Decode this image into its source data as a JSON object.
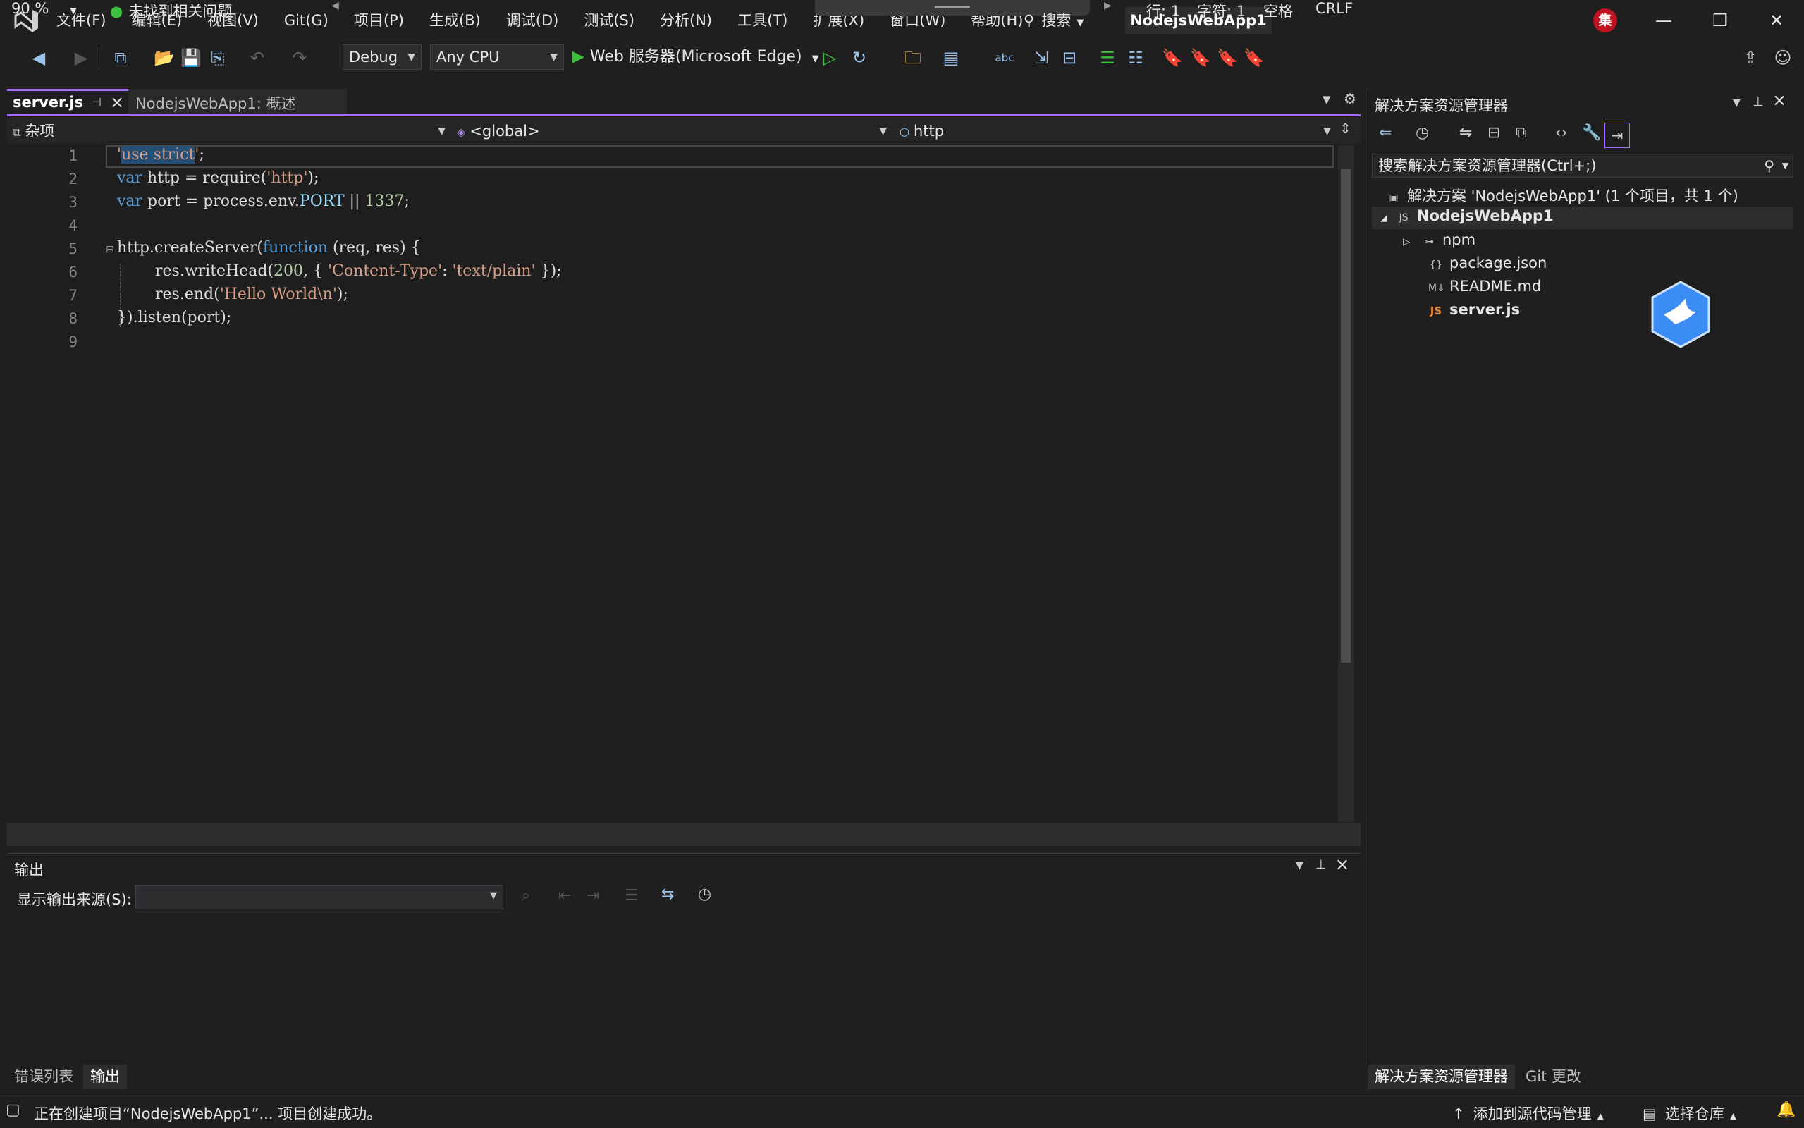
{
  "window": {
    "solution_title": "NodejsWebApp1",
    "search_label": "搜索",
    "avatar_text": "集",
    "minimize": "—",
    "restore": "❐",
    "close": "✕"
  },
  "menu": {
    "items": [
      "文件(F)",
      "编辑(E)",
      "视图(V)",
      "Git(G)",
      "项目(P)",
      "生成(B)",
      "调试(D)",
      "测试(S)",
      "分析(N)",
      "工具(T)",
      "扩展(X)",
      "窗口(W)",
      "帮助(H)"
    ]
  },
  "toolbar": {
    "config": "Debug",
    "platform": "Any CPU",
    "run_label": "Web 服务器(Microsoft Edge)"
  },
  "tabs": {
    "active": "server.js",
    "second": "NodejsWebApp1: 概述"
  },
  "navbar": {
    "project": "杂项",
    "scope": "<global>",
    "member": "http"
  },
  "code": {
    "line_numbers": [
      "1",
      "2",
      "3",
      "4",
      "5",
      "6",
      "7",
      "8",
      "9"
    ],
    "l1_sel": "use strict",
    "l1_rest": ";",
    "l2_kw": "var",
    "l2_a": " http = ",
    "l2_b": "require(",
    "l2_str": "'http'",
    "l2_c": ");",
    "l3_kw": "var",
    "l3_a": " port = process.env.",
    "l3_b": "PORT",
    "l3_c": " || ",
    "l3_num": "1337",
    "l3_d": ";",
    "l5_a": "http.createServer(",
    "l5_kw": "function",
    "l5_b": " (req, res) {",
    "l6_a": "res.writeHead(",
    "l6_num": "200",
    "l6_b": ", { ",
    "l6_str1": "'Content-Type'",
    "l6_c": ": ",
    "l6_str2": "'text/plain'",
    "l6_d": " });",
    "l7_a": "res.end(",
    "l7_str": "'Hello World\\n'",
    "l7_b": ");",
    "l8": "}).listen(port);"
  },
  "editor_status": {
    "zoom": "90 %",
    "issues": "未找到相关问题",
    "line": "行: 1",
    "col": "字符: 1",
    "whitespace": "空格",
    "eol": "CRLF"
  },
  "output": {
    "title": "输出",
    "source_label": "显示输出来源(S):"
  },
  "bottom_tabs": {
    "errors": "错误列表",
    "output": "输出"
  },
  "solution_explorer": {
    "title": "解决方案资源管理器",
    "search_placeholder": "搜索解决方案资源管理器(Ctrl+;)",
    "solution": "解决方案 'NodejsWebApp1' (1 个项目，共 1 个)",
    "project": "NodejsWebApp1",
    "items": [
      "npm",
      "package.json",
      "README.md",
      "server.js"
    ],
    "tab_se": "解决方案资源管理器",
    "tab_git": "Git 更改"
  },
  "statusbar": {
    "message": "正在创建项目“NodejsWebApp1”... 项目创建成功。",
    "add_source": "添加到源代码管理",
    "select_repo": "选择仓库"
  },
  "colors": {
    "accent": "#a66cff",
    "keyword": "#569cd6",
    "string": "#d69d85",
    "number": "#b5cea8",
    "selection": "#264f78"
  }
}
